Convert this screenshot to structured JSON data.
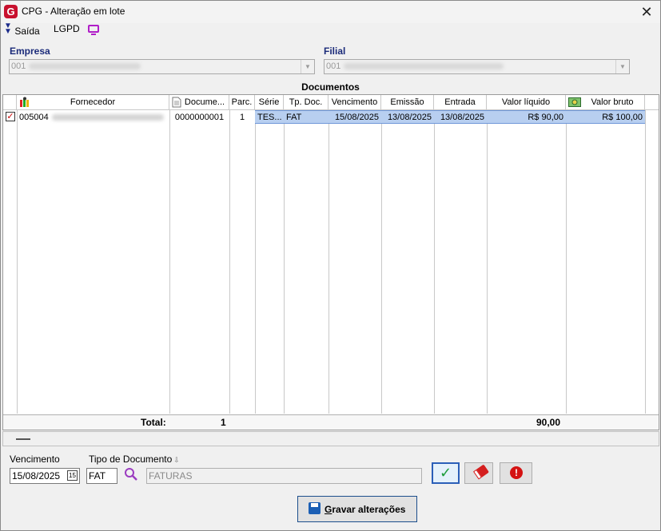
{
  "window": {
    "title": "CPG - Alteração em lote",
    "logo_letter": "G",
    "close_label": "✕"
  },
  "toolbar": {
    "exit_label": "Saída",
    "lgpd_label": "LGPD"
  },
  "empresa": {
    "label": "Empresa",
    "code": "001"
  },
  "filial": {
    "label": "Filial",
    "code": "001"
  },
  "section_title": "Documentos",
  "grid": {
    "columns": [
      "Fornecedor",
      "Docume...",
      "Parc.",
      "Série",
      "Tp. Doc.",
      "Vencimento",
      "Emissão",
      "Entrada",
      "Valor líquido",
      "Valor bruto"
    ],
    "rows": [
      {
        "checked": true,
        "fornecedor_code": "005004",
        "documento": "0000000001",
        "parcela": "1",
        "serie": "TES...",
        "tp_doc": "FAT",
        "vencimento": "15/08/2025",
        "emissao": "13/08/2025",
        "entrada": "13/08/2025",
        "valor_liquido": "R$ 90,00",
        "valor_bruto": "R$ 100,00"
      }
    ],
    "totals": {
      "label": "Total:",
      "count": "1",
      "valor": "90,00"
    }
  },
  "form": {
    "vencimento_label": "Vencimento",
    "vencimento_value": "15/08/2025",
    "calendar_day": "15",
    "tipo_label": "Tipo de Documento",
    "tipo_code": "FAT",
    "tipo_desc": "FATURAS"
  },
  "save_button": {
    "prefix": "G",
    "rest": "ravar alterações"
  }
}
